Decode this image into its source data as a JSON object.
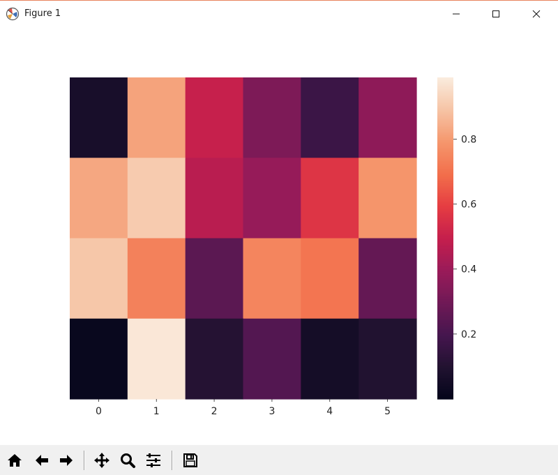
{
  "window": {
    "title": "Figure 1",
    "icon": "matplotlib-logo-icon",
    "controls": [
      "minimize-icon",
      "maximize-icon",
      "close-icon"
    ]
  },
  "toolbar": {
    "buttons": [
      {
        "name": "home-button",
        "icon": "home-icon"
      },
      {
        "name": "back-button",
        "icon": "arrow-left-icon"
      },
      {
        "name": "forward-button",
        "icon": "arrow-right-icon"
      },
      {
        "name": "pan-button",
        "icon": "move-arrows-icon"
      },
      {
        "name": "zoom-button",
        "icon": "magnifier-icon"
      },
      {
        "name": "configure-subplots-button",
        "icon": "sliders-icon"
      },
      {
        "name": "save-button",
        "icon": "floppy-disk-icon"
      }
    ]
  },
  "chart_data": {
    "type": "heatmap",
    "title": "",
    "xlabel": "",
    "ylabel": "",
    "x_ticks": [
      "0",
      "1",
      "2",
      "3",
      "4",
      "5"
    ],
    "y_ticks": [],
    "values": [
      [
        0.07,
        0.82,
        0.5,
        0.33,
        0.17,
        0.37
      ],
      [
        0.83,
        0.91,
        0.47,
        0.39,
        0.57,
        0.79
      ],
      [
        0.9,
        0.74,
        0.25,
        0.75,
        0.71,
        0.27
      ],
      [
        0.02,
        0.98,
        0.11,
        0.23,
        0.06,
        0.1
      ]
    ],
    "colormap": "rocket",
    "vmin": 0.0,
    "vmax": 0.99,
    "colorbar": {
      "ticks": [
        0.2,
        0.4,
        0.6,
        0.8
      ],
      "tick_labels": [
        "0.2",
        "0.4",
        "0.6",
        "0.8"
      ]
    },
    "grid": false
  }
}
